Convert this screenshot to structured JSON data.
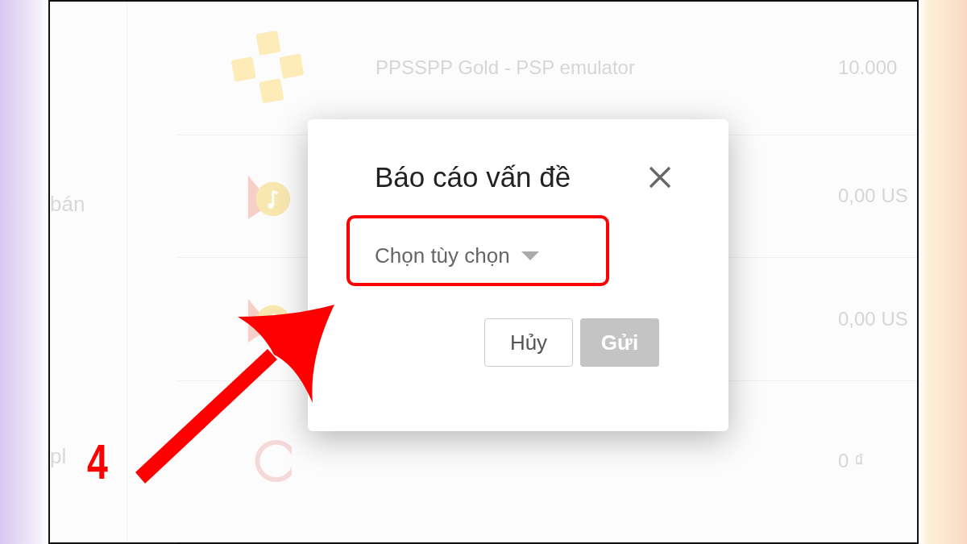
{
  "sidebar": [
    {
      "text": "bán"
    },
    {
      "text": "pl"
    }
  ],
  "apps": [
    {
      "kind": "gamepad",
      "name": "PPSSPP Gold - PSP emulator",
      "price": "10.000"
    },
    {
      "kind": "music",
      "price": "0,00 US"
    },
    {
      "kind": "music",
      "price": "0,00 US"
    },
    {
      "kind": "ring",
      "price": "0 ₫"
    }
  ],
  "dialog": {
    "title": "Báo cáo vấn đề",
    "dropdown": {
      "label": "Chọn tùy chọn"
    },
    "buttons": [
      {
        "label": "Hủy",
        "disabled": false
      },
      {
        "label": "Gửi",
        "disabled": true
      }
    ]
  },
  "annotation": {
    "step": "4"
  }
}
